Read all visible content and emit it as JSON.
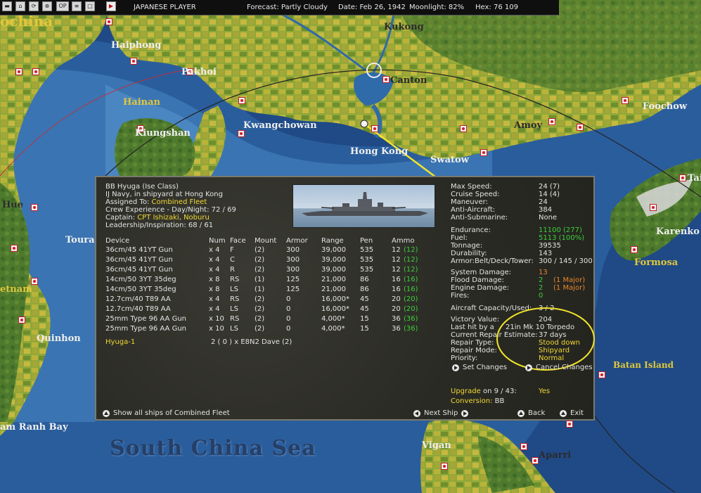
{
  "topbar": {
    "player": "JAPANESE PLAYER",
    "forecast": "Forecast: Partly Cloudy",
    "date": "Date: Feb 26, 1942",
    "moonlight": "Moonlight: 82%",
    "hex": "Hex: 76 109",
    "icons": [
      {
        "name": "menu-icon"
      },
      {
        "name": "reports-icon"
      },
      {
        "name": "refresh-icon"
      },
      {
        "name": "target-icon"
      },
      {
        "name": "op-icon",
        "label": "OP"
      },
      {
        "name": "list-icon"
      },
      {
        "name": "window-icon"
      },
      {
        "name": "play-turn-icon"
      }
    ]
  },
  "map": {
    "sea_label": "South China Sea",
    "places": [
      {
        "id": "ochina",
        "text": "ochina"
      },
      {
        "id": "haiphong",
        "text": "Haiphong"
      },
      {
        "id": "pakhoi",
        "text": "Pakhoi"
      },
      {
        "id": "hainan",
        "text": "Hainan"
      },
      {
        "id": "kiungshan",
        "text": "Kiungshan"
      },
      {
        "id": "kwangchowan",
        "text": "Kwangchowan"
      },
      {
        "id": "kukong",
        "text": "Kukong"
      },
      {
        "id": "canton",
        "text": "Canton"
      },
      {
        "id": "hongkong",
        "text": "Hong Kong"
      },
      {
        "id": "swatow",
        "text": "Swatow"
      },
      {
        "id": "amoy",
        "text": "Amoy"
      },
      {
        "id": "foochow",
        "text": "Foochow"
      },
      {
        "id": "tai",
        "text": "Tai"
      },
      {
        "id": "karenko",
        "text": "Karenko"
      },
      {
        "id": "formosa",
        "text": "Formosa"
      },
      {
        "id": "batan",
        "text": "Batan Island"
      },
      {
        "id": "hue",
        "text": "Hue"
      },
      {
        "id": "touran",
        "text": "Touran"
      },
      {
        "id": "etnam",
        "text": "etnam"
      },
      {
        "id": "quinhon",
        "text": "Quinhon"
      },
      {
        "id": "camranh",
        "text": "am Ranh Bay"
      },
      {
        "id": "vigan",
        "text": "Vigan"
      },
      {
        "id": "aparri",
        "text": "Aparri"
      }
    ]
  },
  "ship": {
    "title": "BB Hyuga (Ise Class)",
    "status": "IJ Navy, in shipyard at Hong Kong",
    "assigned_label": "Assigned To:",
    "assigned_value": "Combined Fleet",
    "crew": "Crew Experience - Day/Night:  72 / 69",
    "captain_label": "Captain:",
    "captain_value": "CPT Ishizaki, Noburu",
    "leadership": "Leadership/Inspiration: 68 / 61",
    "headers": {
      "device": "Device",
      "num": "Num",
      "face": "Face",
      "mount": "Mount",
      "armor": "Armor",
      "range": "Range",
      "pen": "Pen",
      "ammo": "Ammo"
    },
    "devices": [
      {
        "device": "36cm/45 41YT Gun",
        "num": "x 4",
        "face": "F",
        "mount": "(2)",
        "armor": "300",
        "range": "39,000",
        "pen": "535",
        "ammo": "12",
        "ammo_max": "(12)"
      },
      {
        "device": "36cm/45 41YT Gun",
        "num": "x 4",
        "face": "C",
        "mount": "(2)",
        "armor": "300",
        "range": "39,000",
        "pen": "535",
        "ammo": "12",
        "ammo_max": "(12)"
      },
      {
        "device": "36cm/45 41YT Gun",
        "num": "x 4",
        "face": "R",
        "mount": "(2)",
        "armor": "300",
        "range": "39,000",
        "pen": "535",
        "ammo": "12",
        "ammo_max": "(12)"
      },
      {
        "device": "14cm/50 3YT 35deg",
        "num": "x 8",
        "face": "RS",
        "mount": "(1)",
        "armor": "125",
        "range": "21,000",
        "pen": "86",
        "ammo": "16",
        "ammo_max": "(16)"
      },
      {
        "device": "14cm/50 3YT 35deg",
        "num": "x 8",
        "face": "LS",
        "mount": "(1)",
        "armor": "125",
        "range": "21,000",
        "pen": "86",
        "ammo": "16",
        "ammo_max": "(16)"
      },
      {
        "device": "12.7cm/40 T89 AA",
        "num": "x 4",
        "face": "RS",
        "mount": "(2)",
        "armor": "0",
        "range": "16,000*",
        "pen": "45",
        "ammo": "20",
        "ammo_max": "(20)"
      },
      {
        "device": "12.7cm/40 T89 AA",
        "num": "x 4",
        "face": "LS",
        "mount": "(2)",
        "armor": "0",
        "range": "16,000*",
        "pen": "45",
        "ammo": "20",
        "ammo_max": "(20)"
      },
      {
        "device": "25mm Type 96 AA Gun",
        "num": "x 10",
        "face": "RS",
        "mount": "(2)",
        "armor": "0",
        "range": "4,000*",
        "pen": "15",
        "ammo": "36",
        "ammo_max": "(36)"
      },
      {
        "device": "25mm Type 96 AA Gun",
        "num": "x 10",
        "face": "LS",
        "mount": "(2)",
        "armor": "0",
        "range": "4,000*",
        "pen": "15",
        "ammo": "36",
        "ammo_max": "(36)"
      }
    ],
    "air_group": "Hyuga-1",
    "air_group_aircraft": "2 ( 0 ) x E8N2 Dave (2)",
    "stats": [
      {
        "label": "Max Speed:",
        "value": "24  (7)",
        "color": "w"
      },
      {
        "label": "Cruise Speed:",
        "value": "14  (4)",
        "color": "w"
      },
      {
        "label": "Maneuver:",
        "value": "24",
        "color": "w"
      },
      {
        "label": "Anti-Aircraft:",
        "value": "384",
        "color": "w"
      },
      {
        "label": "Anti-Submarine:",
        "value": "None",
        "color": "w"
      },
      {
        "label": "Endurance:",
        "value": "11100  (277)",
        "color": "g"
      },
      {
        "label": "Fuel:",
        "value": "5113  (100%)",
        "color": "g"
      },
      {
        "label": "Tonnage:",
        "value": "39535",
        "color": "w"
      },
      {
        "label": "Durability:",
        "value": "143",
        "color": "w"
      },
      {
        "label": "Armor:Belt/Deck/Tower:",
        "value": "300 / 145 / 300",
        "color": "w"
      },
      {
        "label": "System Damage:",
        "value": "13",
        "color": "o"
      },
      {
        "label": "Flood Damage:",
        "value": "2",
        "note": "(1 Major)",
        "color": "g"
      },
      {
        "label": "Engine Damage:",
        "value": "2",
        "note": "(1 Major)",
        "color": "g"
      },
      {
        "label": "Fires:",
        "value": "0",
        "color": "g"
      },
      {
        "label": "Aircraft Capacity/Used:",
        "value": "3 / 2",
        "color": "w"
      },
      {
        "label": "Victory Value:",
        "value": "204",
        "color": "w"
      },
      {
        "label": "Last hit by a",
        "value": "21in Mk 10 Torpedo",
        "color": "w"
      },
      {
        "label": "Current Repair Estimate:",
        "value": "37 days",
        "color": "w"
      },
      {
        "label": "Repair Type:",
        "value": "Stood down",
        "color": "y"
      },
      {
        "label": "Repair Mode:",
        "value": "Shipyard",
        "color": "y"
      },
      {
        "label": "Priority:",
        "value": "Normal",
        "color": "y"
      }
    ],
    "upgrade_label": "Upgrade",
    "upgrade_date": "on  9 / 43:",
    "upgrade_value": "Yes",
    "conversion_label": "Conversion:",
    "conversion_value": "BB",
    "buttons": {
      "set_changes": "Set Changes",
      "cancel_changes": "Cancel Changes",
      "show_all": "Show all ships of Combined Fleet",
      "next_ship": "Next Ship",
      "back": "Back",
      "exit": "Exit"
    }
  },
  "colors": {
    "highlight": "#f0d832",
    "ok": "#3bcf3b",
    "warn": "#e8862a",
    "panel": "#2c2c26"
  }
}
